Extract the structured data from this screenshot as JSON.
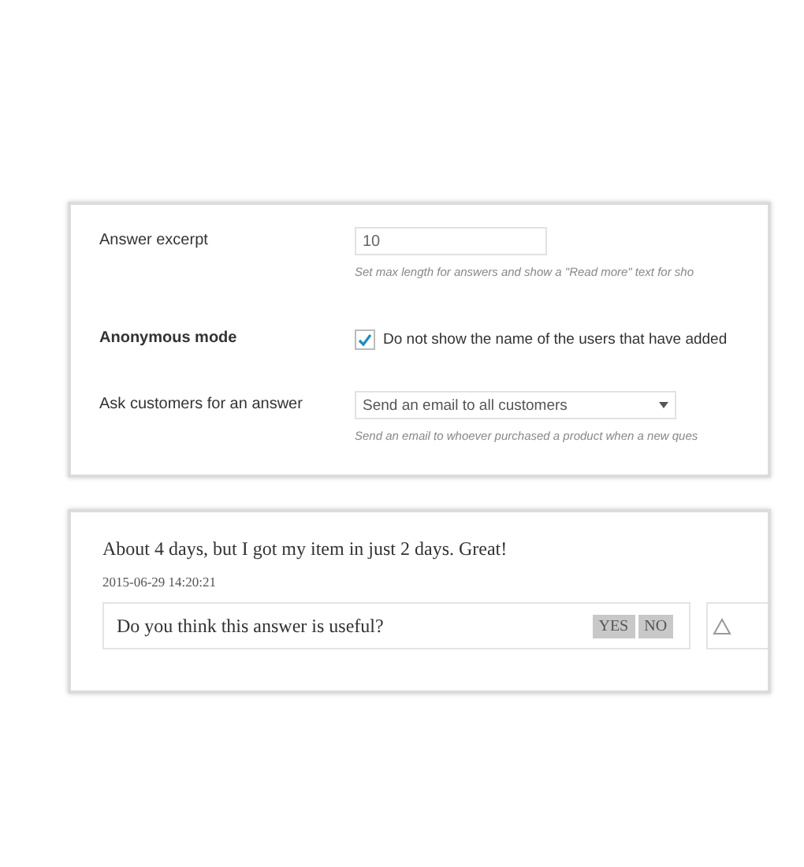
{
  "settings": [
    {
      "kind": "text",
      "label": "Answer excerpt",
      "value": "10",
      "hint": "Set max length for answers and show a \"Read more\" text for sho"
    },
    {
      "kind": "checkbox",
      "label": "Anonymous mode",
      "checked": true,
      "text": "Do not show the name of the users that have added"
    },
    {
      "kind": "select",
      "label": "Ask customers for an answer",
      "value": "Send an email to all customers",
      "hint": "Send an email to whoever purchased a product when a new ques"
    }
  ],
  "answer": {
    "text": "About 4 days, but I got my item in just 2 days. Great!",
    "date": "2015-06-29 14:20:21",
    "question": "Do you think this answer is useful?",
    "buttons": [
      "YES",
      "NO"
    ]
  }
}
